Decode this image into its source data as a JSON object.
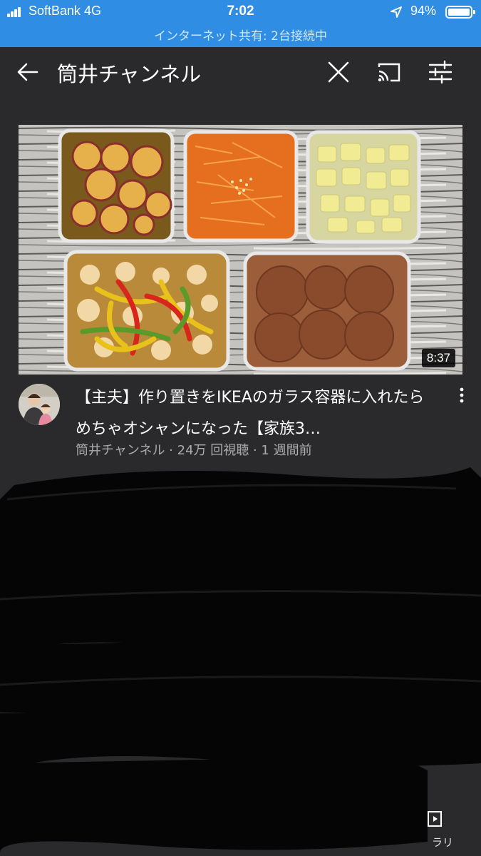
{
  "status": {
    "carrier": "SoftBank  4G",
    "time": "7:02",
    "battery": "94%",
    "battery_level": 0.94,
    "hotspot": "インターネット共有: 2台接続中"
  },
  "header": {
    "query": "筒井チャンネル",
    "icons": [
      "back-arrow-icon",
      "close-icon",
      "cast-icon",
      "filter-icon"
    ]
  },
  "video": {
    "duration": "8:37",
    "title": "【主夫】作り置きをIKEAのガラス容器に入れたらめちゃオシャンになった【家族3…",
    "meta": "筒井チャンネル · 24万 回視聴 · 1 週間前"
  },
  "bottom_nav": {
    "library_label": "ラリ"
  },
  "colors": {
    "status_bar": "#2f8de4",
    "background": "#2a2a2c"
  }
}
